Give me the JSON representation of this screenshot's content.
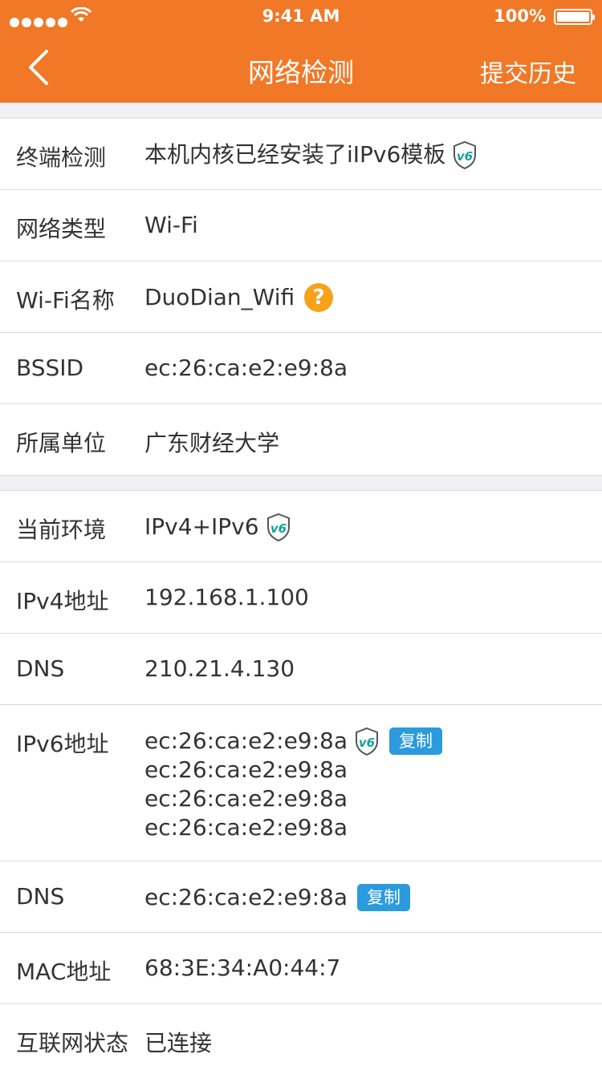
{
  "status_bar": {
    "time": "9:41 AM",
    "battery": "100%"
  },
  "nav": {
    "title": "网络检测",
    "right_action": "提交历史"
  },
  "device_info": [
    {
      "label": "终端检测",
      "value": "本机内核已经安装了iIPv6模板"
    },
    {
      "label": "网络类型",
      "value": "Wi-Fi"
    },
    {
      "label": "Wi-Fi名称",
      "value": "DuoDian_Wifi"
    },
    {
      "label": "BSSID",
      "value": "ec:26:ca:e2:e9:8a"
    },
    {
      "label": "所属单位",
      "value": "广东财经大学"
    }
  ],
  "network_info": {
    "env": {
      "label": "当前环境",
      "value": "IPv4+IPv6"
    },
    "ipv4": {
      "label": "IPv4地址",
      "value": "192.168.1.100"
    },
    "dns4": {
      "label": "DNS",
      "value": "210.21.4.130"
    },
    "ipv6": {
      "label": "IPv6地址",
      "values": [
        "ec:26:ca:e2:e9:8a",
        "ec:26:ca:e2:e9:8a",
        "ec:26:ca:e2:e9:8a",
        "ec:26:ca:e2:e9:8a"
      ],
      "copy_label": "复制"
    },
    "dns6": {
      "label": "DNS",
      "value": "ec:26:ca:e2:e9:8a",
      "copy_label": "复制"
    },
    "mac": {
      "label": "MAC地址",
      "value": "68:3E:34:A0:44:7"
    },
    "internet": {
      "label": "互联网状态",
      "value": "已连接"
    }
  },
  "icons": {
    "ipv6_badge": "v6-shield-icon",
    "help": "question-circle-icon",
    "back": "chevron-left-icon"
  },
  "help_glyph": "?",
  "badge_text": "v6",
  "colors": {
    "accent": "#f07827",
    "copy_button": "#2b9bde",
    "help_icon": "#f6a21a",
    "badge": "#12a39a"
  }
}
